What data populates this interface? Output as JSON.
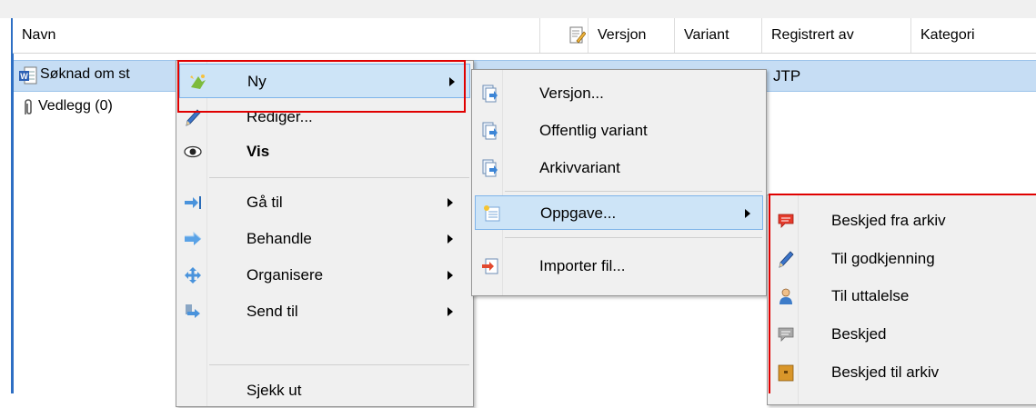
{
  "columns": {
    "navn": "Navn",
    "versjon": "Versjon",
    "variant": "Variant",
    "registrert_av": "Registrert av",
    "kategori": "Kategori"
  },
  "rows": [
    {
      "name": "Søknad om st",
      "registrert_av": "JTP"
    },
    {
      "name": "Vedlegg (0)"
    }
  ],
  "context_menu": {
    "items": [
      {
        "label": "Ny"
      },
      {
        "label": "Rediger..."
      },
      {
        "label": "Vis"
      },
      {
        "label": "Gå til"
      },
      {
        "label": "Behandle"
      },
      {
        "label": "Organisere"
      },
      {
        "label": "Send til"
      },
      {
        "label": "Sjekk ut"
      }
    ]
  },
  "ny_submenu": {
    "items": [
      {
        "label": "Versjon..."
      },
      {
        "label": "Offentlig variant"
      },
      {
        "label": "Arkivvariant"
      },
      {
        "label": "Oppgave..."
      },
      {
        "label": "Importer fil..."
      }
    ]
  },
  "oppgave_submenu": {
    "items": [
      {
        "label": "Beskjed fra arkiv"
      },
      {
        "label": "Til godkjenning"
      },
      {
        "label": "Til uttalelse"
      },
      {
        "label": "Beskjed"
      },
      {
        "label": "Beskjed til arkiv"
      }
    ]
  },
  "colors": {
    "highlight": "#cde4f7",
    "selected_row": "#c6ddf4",
    "annotation_red": "#e00000"
  }
}
